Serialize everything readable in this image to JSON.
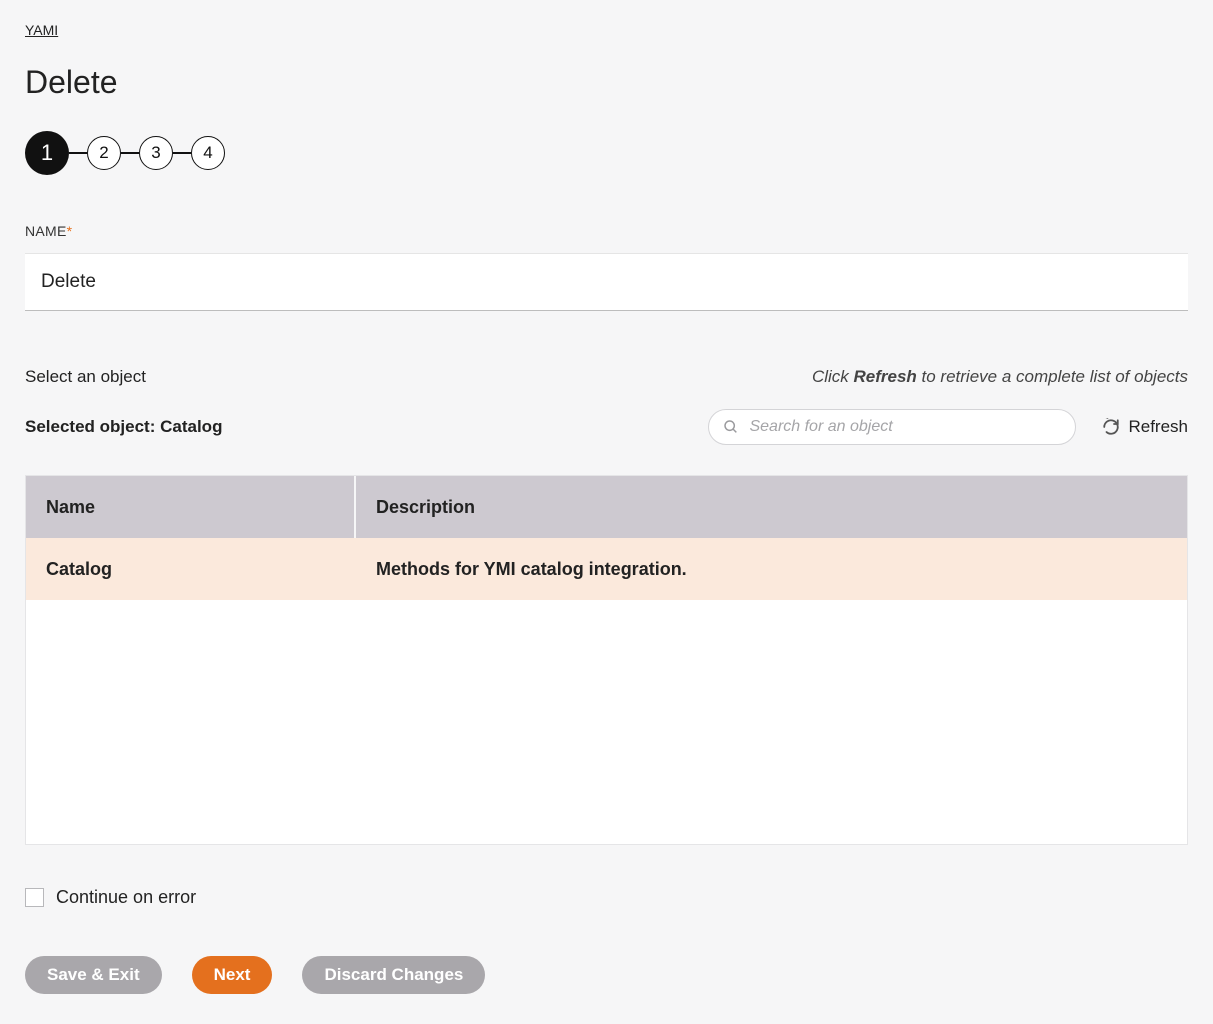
{
  "breadcrumb": {
    "label": "YAMI"
  },
  "title": "Delete",
  "stepper": {
    "steps": [
      "1",
      "2",
      "3",
      "4"
    ],
    "active_index": 0
  },
  "name_field": {
    "label": "NAME",
    "required_mark": "*",
    "value": "Delete"
  },
  "object_section": {
    "select_label": "Select an object",
    "hint_prefix": "Click ",
    "hint_bold": "Refresh",
    "hint_suffix": " to retrieve a complete list of objects",
    "selected_prefix": "Selected object: ",
    "selected_value": "Catalog",
    "search_placeholder": "Search for an object",
    "refresh_label": "Refresh"
  },
  "table": {
    "headers": {
      "name": "Name",
      "description": "Description"
    },
    "rows": [
      {
        "name": "Catalog",
        "description": "Methods for YMI catalog integration."
      }
    ]
  },
  "continue_on_error": {
    "label": "Continue on error",
    "checked": false
  },
  "buttons": {
    "save_exit": "Save & Exit",
    "next": "Next",
    "discard": "Discard Changes"
  }
}
